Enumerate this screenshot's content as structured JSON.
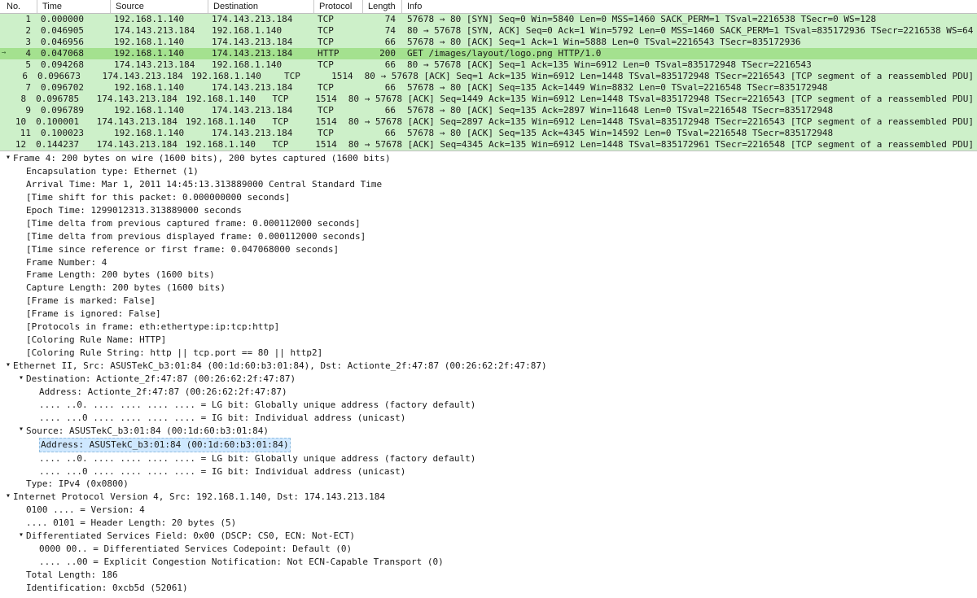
{
  "columns": {
    "no": "No.",
    "time": "Time",
    "src": "Source",
    "dst": "Destination",
    "proto": "Protocol",
    "len": "Length",
    "info": "Info"
  },
  "rows": [
    {
      "n": "1",
      "t": "0.000000",
      "s": "192.168.1.140",
      "d": "174.143.213.184",
      "p": "TCP",
      "l": "74",
      "i": "57678 → 80 [SYN] Seq=0 Win=5840 Len=0 MSS=1460 SACK_PERM=1 TSval=2216538 TSecr=0 WS=128",
      "c": "http"
    },
    {
      "n": "2",
      "t": "0.046905",
      "s": "174.143.213.184",
      "d": "192.168.1.140",
      "p": "TCP",
      "l": "74",
      "i": "80 → 57678 [SYN, ACK] Seq=0 Ack=1 Win=5792 Len=0 MSS=1460 SACK_PERM=1 TSval=835172936 TSecr=2216538 WS=64",
      "c": "http"
    },
    {
      "n": "3",
      "t": "0.046956",
      "s": "192.168.1.140",
      "d": "174.143.213.184",
      "p": "TCP",
      "l": "66",
      "i": "57678 → 80 [ACK] Seq=1 Ack=1 Win=5888 Len=0 TSval=2216543 TSecr=835172936",
      "c": "http"
    },
    {
      "n": "4",
      "t": "0.047068",
      "s": "192.168.1.140",
      "d": "174.143.213.184",
      "p": "HTTP",
      "l": "200",
      "i": "GET /images/layout/logo.png HTTP/1.0",
      "c": "httpS",
      "current": true
    },
    {
      "n": "5",
      "t": "0.094268",
      "s": "174.143.213.184",
      "d": "192.168.1.140",
      "p": "TCP",
      "l": "66",
      "i": "80 → 57678 [ACK] Seq=1 Ack=135 Win=6912 Len=0 TSval=835172948 TSecr=2216543",
      "c": "http"
    },
    {
      "n": "6",
      "t": "0.096673",
      "s": "174.143.213.184",
      "d": "192.168.1.140",
      "p": "TCP",
      "l": "1514",
      "i": "80 → 57678 [ACK] Seq=1 Ack=135 Win=6912 Len=1448 TSval=835172948 TSecr=2216543 [TCP segment of a reassembled PDU]",
      "c": "http"
    },
    {
      "n": "7",
      "t": "0.096702",
      "s": "192.168.1.140",
      "d": "174.143.213.184",
      "p": "TCP",
      "l": "66",
      "i": "57678 → 80 [ACK] Seq=135 Ack=1449 Win=8832 Len=0 TSval=2216548 TSecr=835172948",
      "c": "http"
    },
    {
      "n": "8",
      "t": "0.096785",
      "s": "174.143.213.184",
      "d": "192.168.1.140",
      "p": "TCP",
      "l": "1514",
      "i": "80 → 57678 [ACK] Seq=1449 Ack=135 Win=6912 Len=1448 TSval=835172948 TSecr=2216543 [TCP segment of a reassembled PDU]",
      "c": "http"
    },
    {
      "n": "9",
      "t": "0.096789",
      "s": "192.168.1.140",
      "d": "174.143.213.184",
      "p": "TCP",
      "l": "66",
      "i": "57678 → 80 [ACK] Seq=135 Ack=2897 Win=11648 Len=0 TSval=2216548 TSecr=835172948",
      "c": "http"
    },
    {
      "n": "10",
      "t": "0.100001",
      "s": "174.143.213.184",
      "d": "192.168.1.140",
      "p": "TCP",
      "l": "1514",
      "i": "80 → 57678 [ACK] Seq=2897 Ack=135 Win=6912 Len=1448 TSval=835172948 TSecr=2216543 [TCP segment of a reassembled PDU]",
      "c": "http"
    },
    {
      "n": "11",
      "t": "0.100023",
      "s": "192.168.1.140",
      "d": "174.143.213.184",
      "p": "TCP",
      "l": "66",
      "i": "57678 → 80 [ACK] Seq=135 Ack=4345 Win=14592 Len=0 TSval=2216548 TSecr=835172948",
      "c": "http"
    },
    {
      "n": "12",
      "t": "0.144237",
      "s": "174.143.213.184",
      "d": "192.168.1.140",
      "p": "TCP",
      "l": "1514",
      "i": "80 → 57678 [ACK] Seq=4345 Ack=135 Win=6912 Len=1448 TSval=835172961 TSecr=2216548 [TCP segment of a reassembled PDU]",
      "c": "http"
    }
  ],
  "detail": [
    {
      "ind": 1,
      "tw": "open",
      "txt": "Frame 4: 200 bytes on wire (1600 bits), 200 bytes captured (1600 bits)"
    },
    {
      "ind": 2,
      "tw": "",
      "txt": "Encapsulation type: Ethernet (1)"
    },
    {
      "ind": 2,
      "tw": "",
      "txt": "Arrival Time: Mar  1, 2011 14:45:13.313889000 Central Standard Time"
    },
    {
      "ind": 2,
      "tw": "",
      "txt": "[Time shift for this packet: 0.000000000 seconds]"
    },
    {
      "ind": 2,
      "tw": "",
      "txt": "Epoch Time: 1299012313.313889000 seconds"
    },
    {
      "ind": 2,
      "tw": "",
      "txt": "[Time delta from previous captured frame: 0.000112000 seconds]"
    },
    {
      "ind": 2,
      "tw": "",
      "txt": "[Time delta from previous displayed frame: 0.000112000 seconds]"
    },
    {
      "ind": 2,
      "tw": "",
      "txt": "[Time since reference or first frame: 0.047068000 seconds]"
    },
    {
      "ind": 2,
      "tw": "",
      "txt": "Frame Number: 4"
    },
    {
      "ind": 2,
      "tw": "",
      "txt": "Frame Length: 200 bytes (1600 bits)"
    },
    {
      "ind": 2,
      "tw": "",
      "txt": "Capture Length: 200 bytes (1600 bits)"
    },
    {
      "ind": 2,
      "tw": "",
      "txt": "[Frame is marked: False]"
    },
    {
      "ind": 2,
      "tw": "",
      "txt": "[Frame is ignored: False]"
    },
    {
      "ind": 2,
      "tw": "",
      "txt": "[Protocols in frame: eth:ethertype:ip:tcp:http]"
    },
    {
      "ind": 2,
      "tw": "",
      "txt": "[Coloring Rule Name: HTTP]"
    },
    {
      "ind": 2,
      "tw": "",
      "txt": "[Coloring Rule String: http || tcp.port == 80 || http2]"
    },
    {
      "ind": 1,
      "tw": "open",
      "txt": "Ethernet II, Src: ASUSTekC_b3:01:84 (00:1d:60:b3:01:84), Dst: Actionte_2f:47:87 (00:26:62:2f:47:87)"
    },
    {
      "ind": 2,
      "tw": "open",
      "txt": "Destination: Actionte_2f:47:87 (00:26:62:2f:47:87)"
    },
    {
      "ind": 3,
      "tw": "",
      "txt": "Address: Actionte_2f:47:87 (00:26:62:2f:47:87)"
    },
    {
      "ind": 3,
      "tw": "",
      "txt": ".... ..0. .... .... .... .... = LG bit: Globally unique address (factory default)"
    },
    {
      "ind": 3,
      "tw": "",
      "txt": ".... ...0 .... .... .... .... = IG bit: Individual address (unicast)"
    },
    {
      "ind": 2,
      "tw": "open",
      "txt": "Source: ASUSTekC_b3:01:84 (00:1d:60:b3:01:84)"
    },
    {
      "ind": 3,
      "tw": "",
      "txt": "Address: ASUSTekC_b3:01:84 (00:1d:60:b3:01:84)",
      "sel": true
    },
    {
      "ind": 3,
      "tw": "",
      "txt": ".... ..0. .... .... .... .... = LG bit: Globally unique address (factory default)"
    },
    {
      "ind": 3,
      "tw": "",
      "txt": ".... ...0 .... .... .... .... = IG bit: Individual address (unicast)"
    },
    {
      "ind": 2,
      "tw": "",
      "txt": "Type: IPv4 (0x0800)"
    },
    {
      "ind": 1,
      "tw": "open",
      "txt": "Internet Protocol Version 4, Src: 192.168.1.140, Dst: 174.143.213.184"
    },
    {
      "ind": 2,
      "tw": "",
      "txt": "0100 .... = Version: 4"
    },
    {
      "ind": 2,
      "tw": "",
      "txt": ".... 0101 = Header Length: 20 bytes (5)"
    },
    {
      "ind": 2,
      "tw": "open",
      "txt": "Differentiated Services Field: 0x00 (DSCP: CS0, ECN: Not-ECT)"
    },
    {
      "ind": 3,
      "tw": "",
      "txt": "0000 00.. = Differentiated Services Codepoint: Default (0)"
    },
    {
      "ind": 3,
      "tw": "",
      "txt": ".... ..00 = Explicit Congestion Notification: Not ECN-Capable Transport (0)"
    },
    {
      "ind": 2,
      "tw": "",
      "txt": "Total Length: 186"
    },
    {
      "ind": 2,
      "tw": "",
      "txt": "Identification: 0xcb5d (52061)"
    }
  ]
}
